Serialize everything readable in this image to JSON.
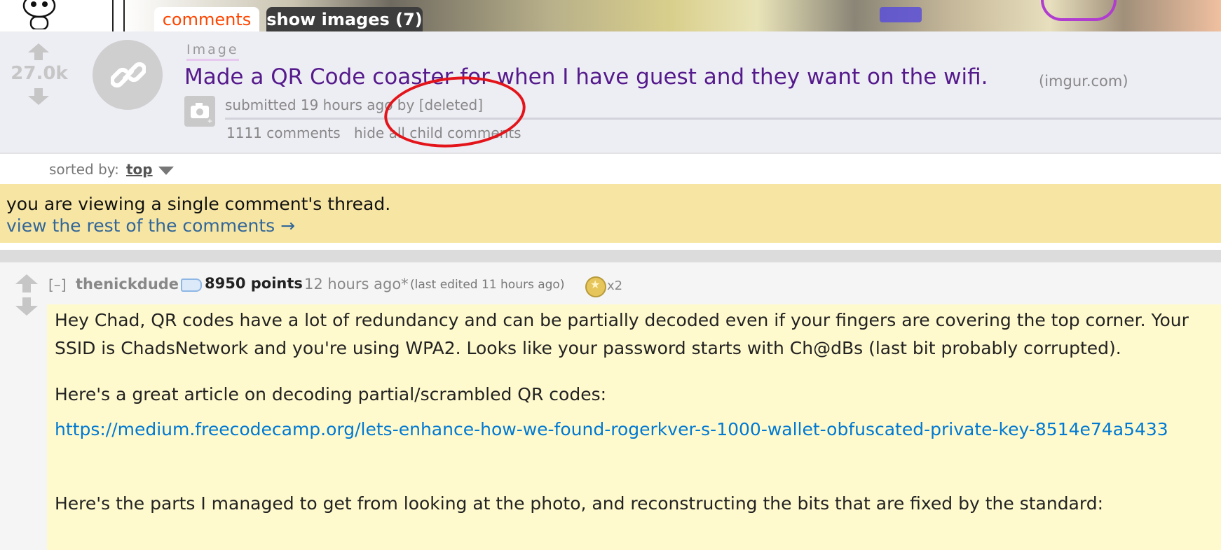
{
  "header": {
    "tabs": [
      {
        "label": "comments",
        "active": true
      },
      {
        "label": "show images (7)",
        "active": false
      }
    ],
    "accent_color": "#ff4500"
  },
  "post": {
    "score": "27.0k",
    "flair": "Image",
    "title": "Made a QR Code coaster for when I have guest and they want on the wifi.",
    "domain": "(imgur.com)",
    "tagline": "submitted 19 hours ago by [deleted]",
    "comments_link": "1111 comments",
    "hide_link": "hide all child comments",
    "title_color": "#551a8b"
  },
  "sort": {
    "label": "sorted by:",
    "value": "top"
  },
  "notice": {
    "text": "you are viewing a single comment's thread.",
    "link": "view the rest of the comments →"
  },
  "comment": {
    "collapse": "[–]",
    "author": "thenickdude",
    "points": "8950 points",
    "time": "12 hours ago*",
    "edited": "(last edited 11 hours ago)",
    "award_count": "x2",
    "paragraphs": [
      "Hey Chad, QR codes have a lot of redundancy and can be partially decoded even if your fingers are covering the top corner. Your SSID is ChadsNetwork and you're using WPA2. Looks like your password starts with Ch@dBs (last bit probably corrupted).",
      "Here's a great article on decoding partial/scrambled QR codes:",
      "https://medium.freecodecamp.org/lets-enhance-how-we-found-rogerkver-s-1000-wallet-obfuscated-private-key-8514e74a5433",
      "Here's the parts I managed to get from looking at the photo, and reconstructing the bits that are fixed by the standard:"
    ],
    "link_color": "#0079d3",
    "body_bg": "#fffacd"
  }
}
